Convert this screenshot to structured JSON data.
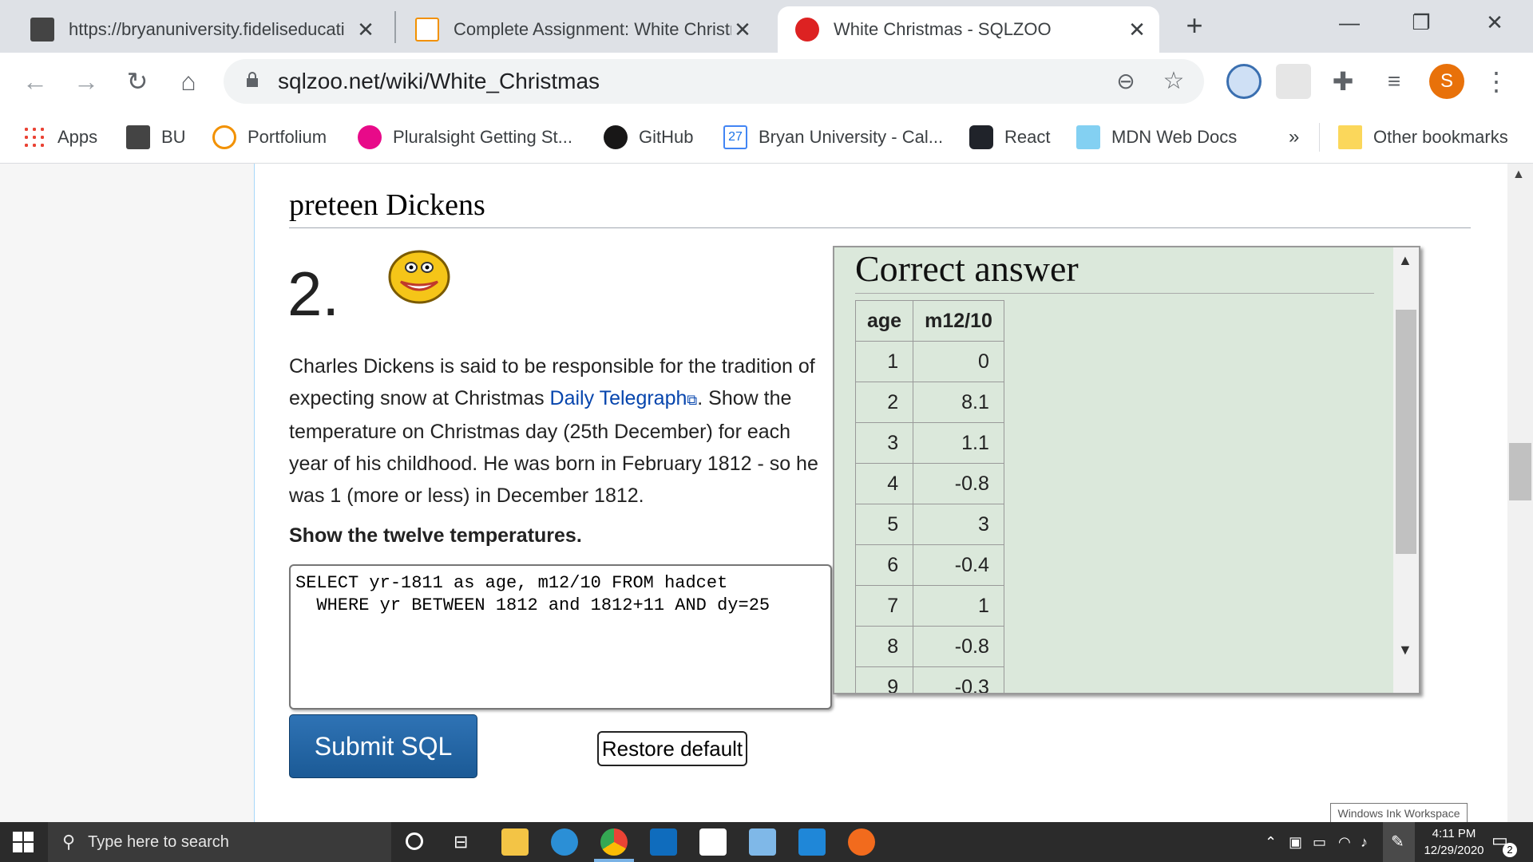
{
  "browser": {
    "tabs": [
      {
        "title": "https://bryanuniversity.fideliseducati",
        "active": false
      },
      {
        "title": "Complete Assignment: White Christm",
        "active": false
      },
      {
        "title": "White Christmas - SQLZOO",
        "active": true
      }
    ],
    "new_tab_label": "+",
    "url": "sqlzoo.net/wiki/White_Christmas",
    "profile_initial": "S",
    "bookmarks": [
      {
        "label": "Apps"
      },
      {
        "label": "BU"
      },
      {
        "label": "Portfolium"
      },
      {
        "label": "Pluralsight Getting St..."
      },
      {
        "label": "GitHub"
      },
      {
        "label": "Bryan University - Cal..."
      },
      {
        "label": "React"
      },
      {
        "label": "MDN Web Docs"
      }
    ],
    "more_bookmarks": "»",
    "other_bookmarks": "Other bookmarks",
    "calendar_day": "27"
  },
  "page": {
    "heading": "preteen Dickens",
    "question_number": "2.",
    "para_before_link": "Charles Dickens is said to be responsible for the tradition of expecting snow at Christmas ",
    "link_text": "Daily Telegraph",
    "para_after_link": ". Show the temperature on Christmas day (25th December) for each year of his childhood. He was born in February 1812 - so he was 1 (more or less) in December 1812.",
    "instruction": "Show the twelve temperatures.",
    "sql": "SELECT yr-1811 as age, m12/10 FROM hadcet\n  WHERE yr BETWEEN 1812 and 1812+11 AND dy=25",
    "submit_label": "Submit SQL",
    "restore_label": "Restore default"
  },
  "answer": {
    "title": "Correct answer",
    "columns": [
      "age",
      "m12/10"
    ],
    "rows": [
      [
        "1",
        "0"
      ],
      [
        "2",
        "8.1"
      ],
      [
        "3",
        "1.1"
      ],
      [
        "4",
        "-0.8"
      ],
      [
        "5",
        "3"
      ],
      [
        "6",
        "-0.4"
      ],
      [
        "7",
        "1"
      ],
      [
        "8",
        "-0.8"
      ],
      [
        "9",
        "-0.3"
      ]
    ]
  },
  "overlay": {
    "ink_workspace": "Windows Ink Workspace"
  },
  "taskbar": {
    "search_placeholder": "Type here to search",
    "time": "4:11 PM",
    "date": "12/29/2020",
    "notification_count": "2"
  }
}
